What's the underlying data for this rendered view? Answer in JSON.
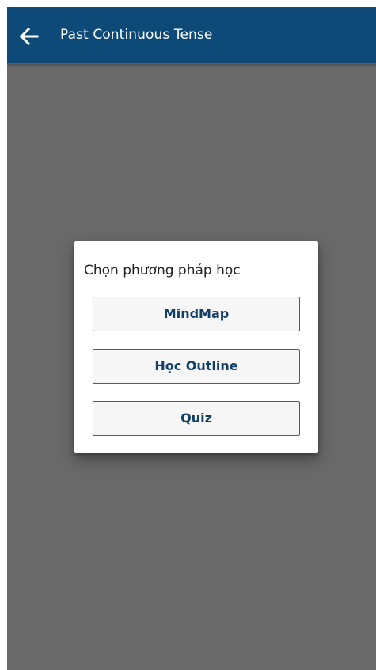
{
  "app_bar": {
    "back_icon": "arrow-left-icon",
    "title": "Past Continuous Tense",
    "background_color": "#0d4a78",
    "text_color": "#ffffff"
  },
  "overlay": {
    "color": "#696969"
  },
  "dialog": {
    "title": "Chọn phương pháp học",
    "options": [
      {
        "label": "MindMap"
      },
      {
        "label": "Học Outline"
      },
      {
        "label": "Quiz"
      }
    ],
    "button_text_color": "#123f68",
    "button_border_color": "#4a5f74"
  }
}
